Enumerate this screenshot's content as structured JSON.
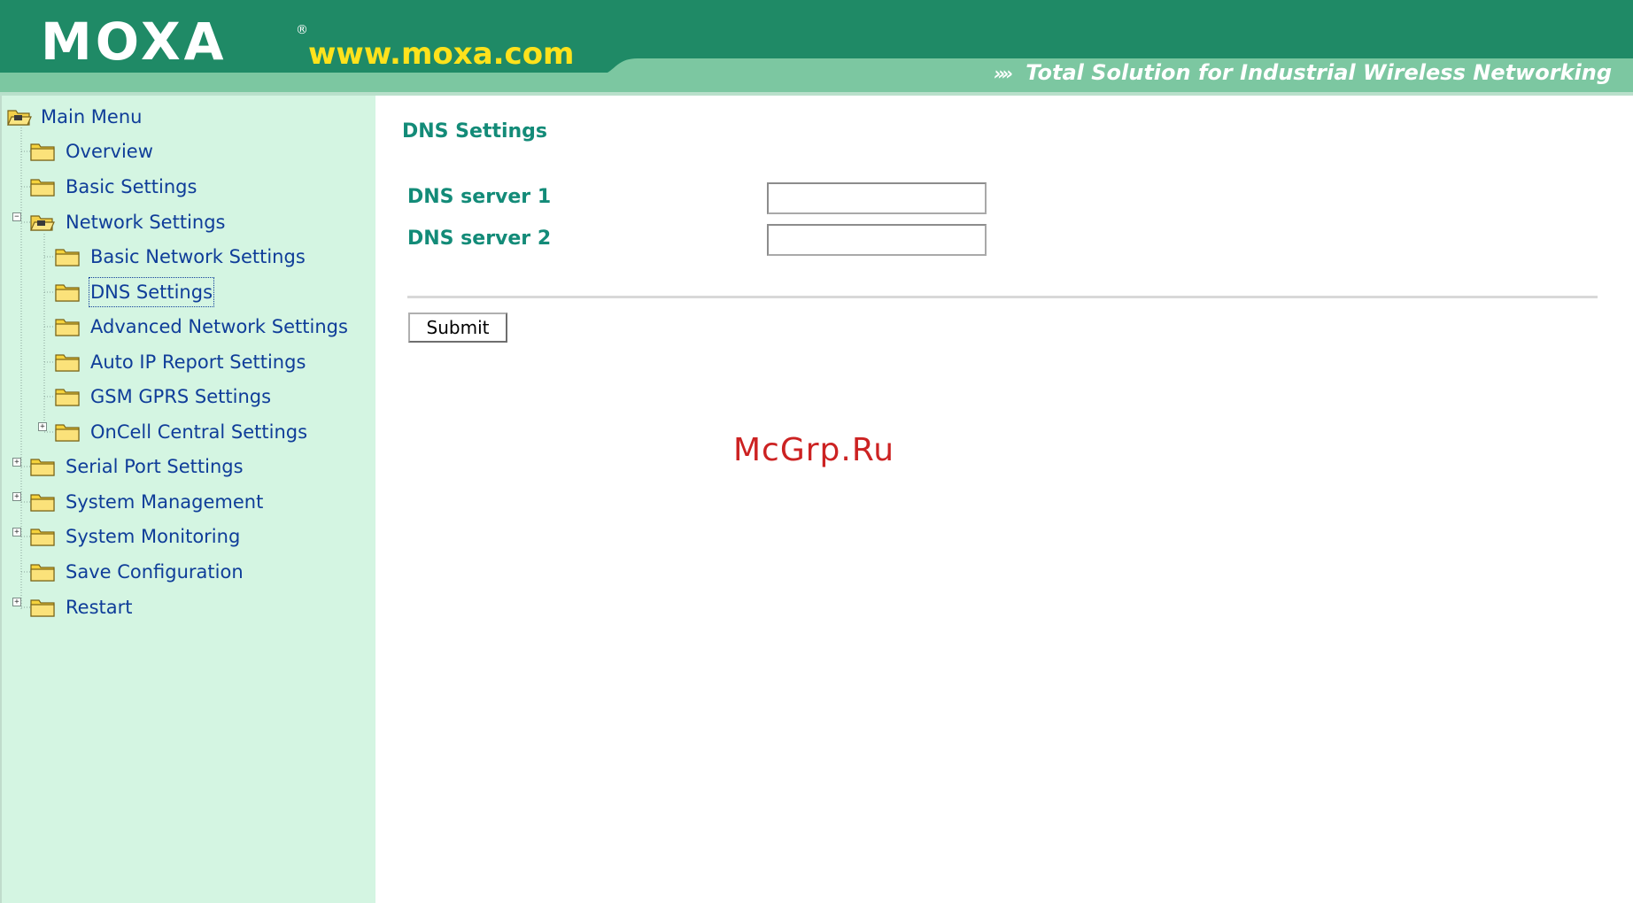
{
  "header": {
    "logo_text": "MOXA",
    "registered_mark": "®",
    "url_text": "www.moxa.com",
    "tagline_arrows": "»»",
    "tagline": "Total Solution for Industrial Wireless Networking",
    "colors": {
      "header_dark": "#1f8a66",
      "header_light": "#7cc7a1",
      "url": "#ffe21c"
    }
  },
  "sidebar": {
    "background": "#d4f5e2",
    "items": [
      {
        "label": "Main Menu",
        "icon": "open-folder-icon"
      },
      {
        "label": "Overview",
        "icon": "folder-icon"
      },
      {
        "label": "Basic Settings",
        "icon": "folder-icon"
      },
      {
        "label": "Network Settings",
        "icon": "open-folder-icon",
        "expander": "minus"
      },
      {
        "label": "Basic Network Settings",
        "icon": "folder-icon"
      },
      {
        "label": "DNS Settings",
        "icon": "folder-icon",
        "selected": true
      },
      {
        "label": "Advanced Network Settings",
        "icon": "folder-icon"
      },
      {
        "label": "Auto IP Report Settings",
        "icon": "folder-icon"
      },
      {
        "label": "GSM GPRS Settings",
        "icon": "folder-icon"
      },
      {
        "label": "OnCell Central Settings",
        "icon": "folder-icon",
        "expander": "plus"
      },
      {
        "label": "Serial Port Settings",
        "icon": "folder-icon",
        "expander": "plus"
      },
      {
        "label": "System Management",
        "icon": "folder-icon",
        "expander": "plus"
      },
      {
        "label": "System Monitoring",
        "icon": "folder-icon",
        "expander": "plus"
      },
      {
        "label": "Save Configuration",
        "icon": "folder-icon"
      },
      {
        "label": "Restart",
        "icon": "folder-icon",
        "expander": "plus"
      }
    ]
  },
  "main": {
    "title": "DNS Settings",
    "fields": [
      {
        "label": "DNS server 1",
        "value": "",
        "placeholder": ""
      },
      {
        "label": "DNS server 2",
        "value": "",
        "placeholder": ""
      }
    ],
    "submit_label": "Submit",
    "label_color": "#138b78"
  },
  "watermark": "McGrp.Ru"
}
